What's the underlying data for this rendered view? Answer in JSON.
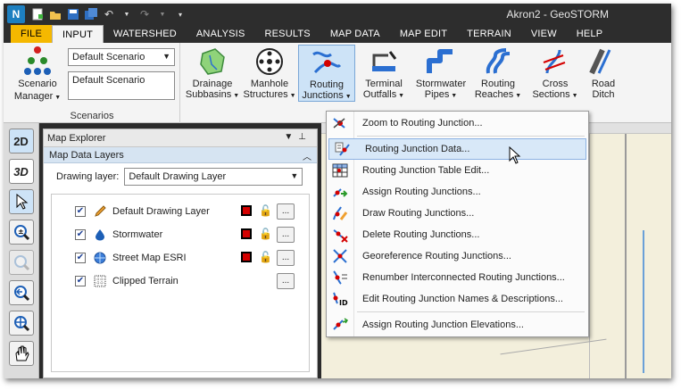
{
  "window": {
    "title": "Akron2 - GeoSTORM",
    "app_icon": "app-logo-icon",
    "quick_access": [
      "new-icon",
      "open-icon",
      "save-icon",
      "save-all-icon",
      "undo-icon",
      "redo-icon",
      "customize-icon"
    ]
  },
  "tabs": [
    "FILE",
    "INPUT",
    "WATERSHED",
    "ANALYSIS",
    "RESULTS",
    "MAP DATA",
    "MAP EDIT",
    "TERRAIN",
    "VIEW",
    "HELP"
  ],
  "active_tab": "INPUT",
  "scenarios": {
    "manager_label_1": "Scenario",
    "manager_label_2": "Manager",
    "selected": "Default Scenario",
    "description": "Default Scenario",
    "caption": "Scenarios"
  },
  "ribbon_buttons": [
    {
      "line1": "Drainage",
      "line2": "Subbasins",
      "icon": "drainage-subbasins-icon"
    },
    {
      "line1": "Manhole",
      "line2": "Structures",
      "icon": "manhole-structures-icon"
    },
    {
      "line1": "Routing",
      "line2": "Junctions",
      "icon": "routing-junctions-icon"
    },
    {
      "line1": "Terminal",
      "line2": "Outfalls",
      "icon": "terminal-outfalls-icon"
    },
    {
      "line1": "Stormwater",
      "line2": "Pipes",
      "icon": "stormwater-pipes-icon"
    },
    {
      "line1": "Routing",
      "line2": "Reaches",
      "icon": "routing-reaches-icon"
    },
    {
      "line1": "Cross",
      "line2": "Sections",
      "icon": "cross-sections-icon"
    },
    {
      "line1": "Road",
      "line2": "Ditch",
      "icon": "road-ditch-icon"
    }
  ],
  "toolstrip": [
    "2D",
    "3D",
    "select-icon",
    "zoom-extents-icon",
    "zoom-in-icon",
    "zoom-previous-icon",
    "zoom-window-icon",
    "pan-icon"
  ],
  "explorer": {
    "title": "Map Explorer",
    "section": "Map Data Layers",
    "drawing_layer_label": "Drawing layer:",
    "drawing_layer_value": "Default Drawing Layer",
    "layers": [
      {
        "name": "Default Drawing Layer",
        "checked": true,
        "icon": "pencil-icon"
      },
      {
        "name": "Stormwater",
        "checked": true,
        "icon": "water-drop-icon"
      },
      {
        "name": "Street Map ESRI",
        "checked": true,
        "icon": "globe-icon"
      },
      {
        "name": "Clipped Terrain",
        "checked": true,
        "icon": "terrain-grid-icon"
      }
    ],
    "more_label": "..."
  },
  "menu": {
    "items": [
      {
        "label": "Zoom to Routing Junction...",
        "icon": "zoom-junction-icon"
      },
      {
        "label": "Routing Junction Data...",
        "icon": "junction-data-icon"
      },
      {
        "label": "Routing Junction Table Edit...",
        "icon": "table-edit-icon"
      },
      {
        "label": "Assign Routing Junctions...",
        "icon": "assign-junction-icon"
      },
      {
        "label": "Draw Routing Junctions...",
        "icon": "draw-junction-icon"
      },
      {
        "label": "Delete Routing Junctions...",
        "icon": "delete-junction-icon"
      },
      {
        "label": "Georeference Routing Junctions...",
        "icon": "georeference-icon"
      },
      {
        "label": "Renumber Interconnected Routing Junctions...",
        "icon": "renumber-icon"
      },
      {
        "label": "Edit Routing Junction Names & Descriptions...",
        "icon": "edit-names-icon"
      },
      {
        "label": "Assign Routing Junction Elevations...",
        "icon": "assign-elevations-icon"
      }
    ]
  },
  "colors": {
    "accent": "#f5b800",
    "hover": "#d8e8f8",
    "swatch": "#d40000",
    "map_bg": "#f3efdc"
  }
}
